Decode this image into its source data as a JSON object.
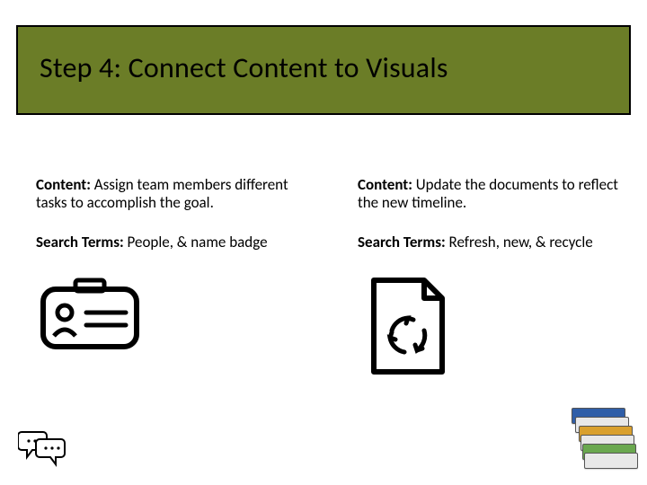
{
  "slide": {
    "title": "Step 4: Connect Content to Visuals"
  },
  "left": {
    "content_label": "Content:",
    "content_text": " Assign team members different tasks to accomplish the goal.",
    "search_label": "Search Terms:",
    "search_text": " People, & name badge"
  },
  "right": {
    "content_label": "Content:",
    "content_text": " Update the documents to reflect the new timeline.",
    "search_label": "Search Terms:",
    "search_text": " Refresh, new, & recycle"
  },
  "icons": {
    "left_alt": "name-badge-icon",
    "right_alt": "document-recycle-icon",
    "corner_alt": "chat-bubbles-icon",
    "decor_alt": "stacked-cards-decoration"
  }
}
